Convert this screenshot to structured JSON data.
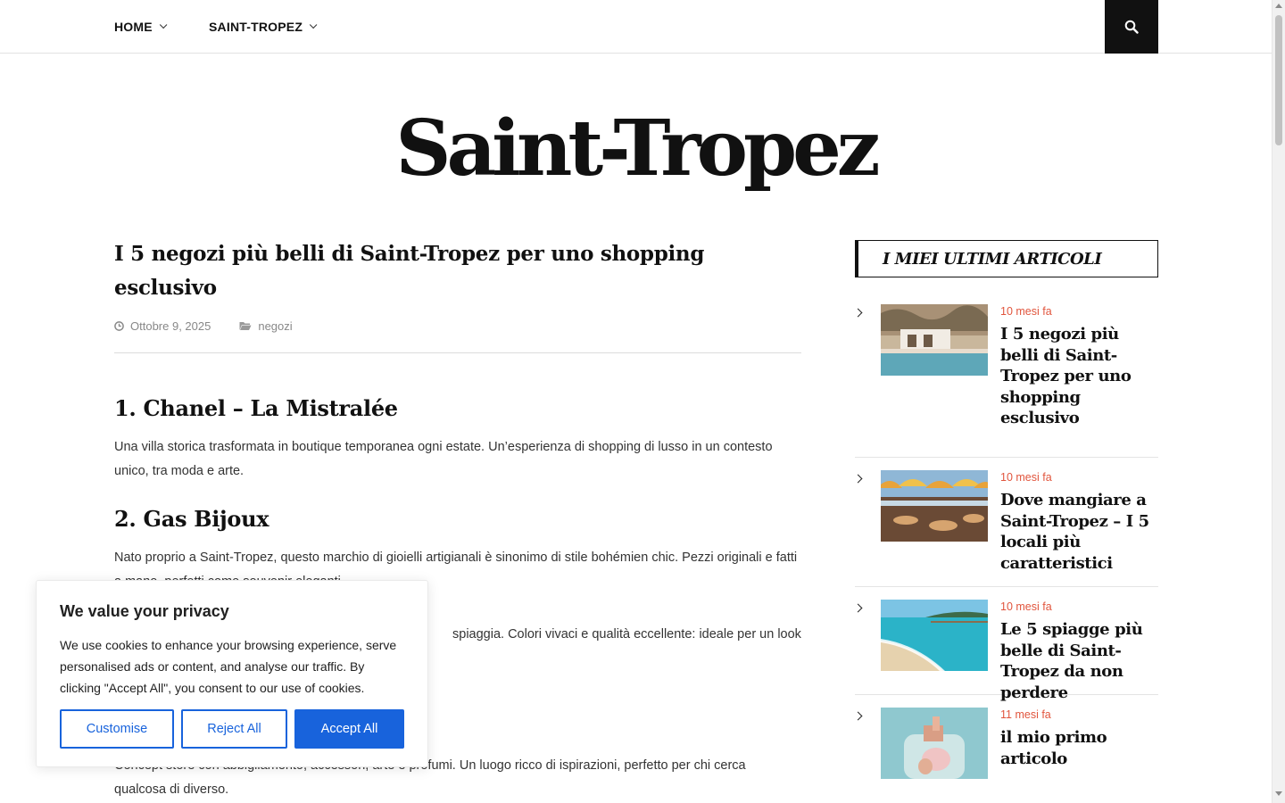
{
  "nav": {
    "items": [
      {
        "label": "HOME"
      },
      {
        "label": "SAINT-TROPEZ"
      }
    ],
    "search_icon": "search-icon"
  },
  "site": {
    "title": "Saint-Tropez"
  },
  "article": {
    "title": "I 5 negozi più belli di Saint-Tropez per uno shopping esclusivo",
    "date": "Ottobre 9, 2025",
    "category": "negozi",
    "sections": [
      {
        "heading": "1. Chanel – La Mistralée",
        "text": "Una villa storica trasformata in boutique temporanea ogni estate. Un’esperienza di shopping di lusso in un contesto unico, tra moda e arte."
      },
      {
        "heading": "2. Gas Bijoux",
        "text": "Nato proprio a Saint-Tropez, questo marchio di gioielli artigianali è sinonimo di stile bohémien chic. Pezzi originali e fatti a mano, perfetti come souvenir eleganti."
      },
      {
        "heading": "",
        "text": "spiaggia. Colori vivaci e qualità eccellente: ideale per un look"
      },
      {
        "heading": "",
        "text": "Concept store con abbigliamento, accessori, arte e profumi. Un luogo ricco di ispirazioni, perfetto per chi cerca qualcosa di diverso."
      }
    ]
  },
  "sidebar": {
    "widget_title": "I MIEI ULTIMI ARTICOLI",
    "posts": [
      {
        "ago": "10 mesi fa",
        "title": "I 5 negozi più belli di Saint-Tropez per uno shopping esclusivo"
      },
      {
        "ago": "10 mesi fa",
        "title": "Dove mangiare a Saint-Tropez – I 5 locali più caratteristici"
      },
      {
        "ago": "10 mesi fa",
        "title": "Le 5 spiagge più belle di Saint-Tropez da non perdere"
      },
      {
        "ago": "11 mesi fa",
        "title": "il mio primo articolo"
      }
    ]
  },
  "cookie": {
    "title": "We value your privacy",
    "text": "We use cookies to enhance your browsing experience, serve personalised ads or content, and analyse our traffic. By clicking \"Accept All\", you consent to our use of cookies.",
    "customise": "Customise",
    "reject": "Reject All",
    "accept": "Accept All"
  },
  "colors": {
    "accent": "#e1553d",
    "cookie_blue": "#1863dc",
    "dark": "#111111"
  }
}
